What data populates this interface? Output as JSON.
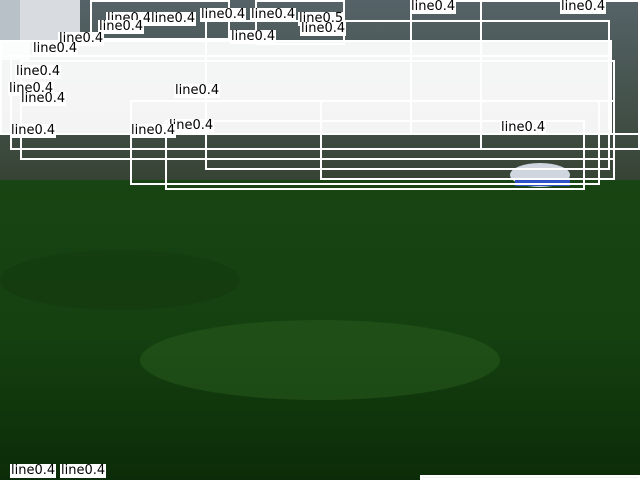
{
  "scene": {
    "description_colors": {
      "field": "#1f5218",
      "field_dark": "#0a2a07",
      "box": "#ffffff",
      "bumper": "#3050c8"
    }
  },
  "detections": {
    "class_label": "line",
    "labels": [
      "line0.4",
      "line0.4",
      "line0.4",
      "line0.5",
      "line0.4",
      "line0.4",
      "line0.4",
      "line0.4",
      "line0.4",
      "line0.4",
      "line0.4",
      "line0.4",
      "line0.4",
      "line0.4",
      "line0.4",
      "line0.4",
      "line0.4",
      "line0.4",
      "line0.4",
      "line0.4",
      "line0.4",
      "line0.4"
    ]
  }
}
